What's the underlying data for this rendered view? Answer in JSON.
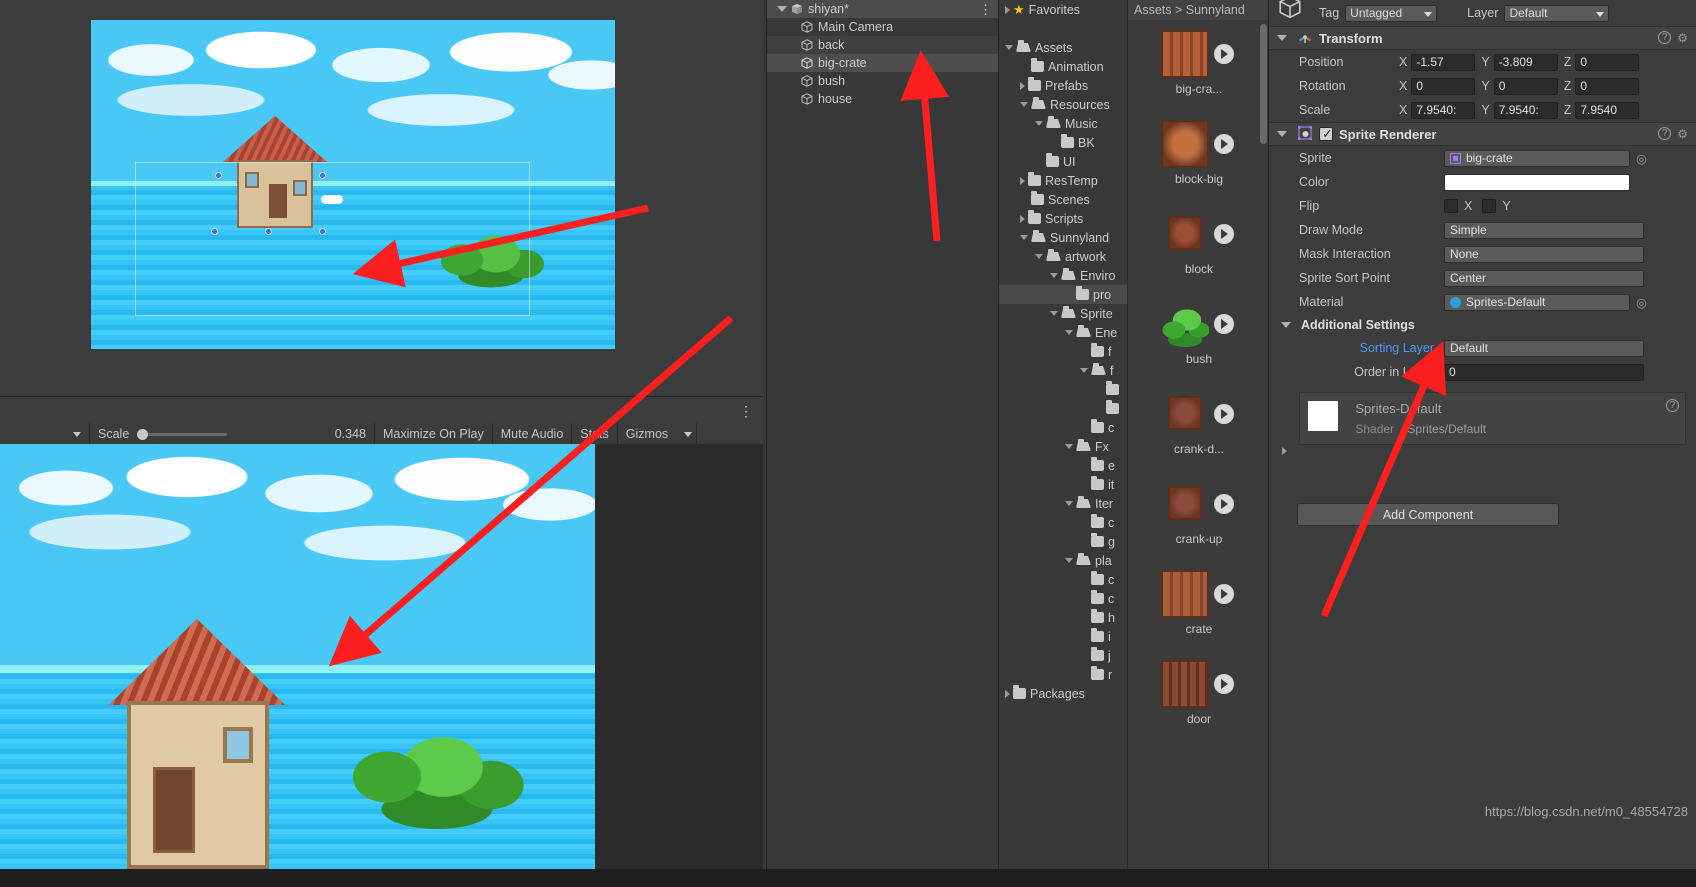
{
  "scene": {
    "frame_label": "scene-camera-frame"
  },
  "game_toolbar": {
    "scale_label": "Scale",
    "scale_value": "0.348",
    "maximize_label": "Maximize On Play",
    "mute_label": "Mute Audio",
    "stats_label": "Stats",
    "gizmos_label": "Gizmos"
  },
  "hierarchy": {
    "scene_name": "shiyan*",
    "items": [
      {
        "label": "Main Camera",
        "selected": false
      },
      {
        "label": "back",
        "selected": false
      },
      {
        "label": "big-crate",
        "selected": true
      },
      {
        "label": "bush",
        "selected": false
      },
      {
        "label": "house",
        "selected": false
      }
    ]
  },
  "project": {
    "favorites_label": "Favorites",
    "breadcrumb": "Assets  >  Sunnyland",
    "tree": [
      {
        "label": "Favorites",
        "depth": 0,
        "tri": "right",
        "icon": "star",
        "selected": false
      },
      {
        "label": "",
        "depth": 0,
        "tri": "blank",
        "icon": "none",
        "selected": false
      },
      {
        "label": "Assets",
        "depth": 0,
        "tri": "down",
        "icon": "folder-open",
        "selected": false
      },
      {
        "label": "Animation",
        "depth": 1,
        "tri": "blank",
        "icon": "folder",
        "selected": false
      },
      {
        "label": "Prefabs",
        "depth": 1,
        "tri": "right",
        "icon": "folder",
        "selected": false
      },
      {
        "label": "Resources",
        "depth": 1,
        "tri": "down",
        "icon": "folder-open",
        "selected": false
      },
      {
        "label": "Music",
        "depth": 2,
        "tri": "down",
        "icon": "folder-open",
        "selected": false
      },
      {
        "label": "BK",
        "depth": 3,
        "tri": "blank",
        "icon": "folder",
        "selected": false
      },
      {
        "label": "UI",
        "depth": 2,
        "tri": "blank",
        "icon": "folder",
        "selected": false
      },
      {
        "label": "ResTemp",
        "depth": 1,
        "tri": "right",
        "icon": "folder",
        "selected": false
      },
      {
        "label": "Scenes",
        "depth": 1,
        "tri": "blank",
        "icon": "folder",
        "selected": false
      },
      {
        "label": "Scripts",
        "depth": 1,
        "tri": "right",
        "icon": "folder",
        "selected": false
      },
      {
        "label": "Sunnyland",
        "depth": 1,
        "tri": "down",
        "icon": "folder-open",
        "selected": false
      },
      {
        "label": "artwork",
        "depth": 2,
        "tri": "down",
        "icon": "folder-open",
        "selected": false
      },
      {
        "label": "Enviro",
        "depth": 3,
        "tri": "down",
        "icon": "folder-open",
        "selected": false
      },
      {
        "label": "pro",
        "depth": 4,
        "tri": "blank",
        "icon": "folder",
        "selected": true
      },
      {
        "label": "Sprite",
        "depth": 3,
        "tri": "down",
        "icon": "folder-open",
        "selected": false
      },
      {
        "label": "Ene",
        "depth": 4,
        "tri": "down",
        "icon": "folder-open",
        "selected": false
      },
      {
        "label": "f",
        "depth": 5,
        "tri": "blank",
        "icon": "folder",
        "selected": false
      },
      {
        "label": "f",
        "depth": 5,
        "tri": "down",
        "icon": "folder-open",
        "selected": false
      },
      {
        "label": "",
        "depth": 6,
        "tri": "blank",
        "icon": "folder",
        "selected": false
      },
      {
        "label": "",
        "depth": 6,
        "tri": "blank",
        "icon": "folder",
        "selected": false
      },
      {
        "label": "c",
        "depth": 5,
        "tri": "blank",
        "icon": "folder",
        "selected": false
      },
      {
        "label": "Fx",
        "depth": 4,
        "tri": "down",
        "icon": "folder-open",
        "selected": false
      },
      {
        "label": "e",
        "depth": 5,
        "tri": "blank",
        "icon": "folder",
        "selected": false
      },
      {
        "label": "it",
        "depth": 5,
        "tri": "blank",
        "icon": "folder",
        "selected": false
      },
      {
        "label": "Iter",
        "depth": 4,
        "tri": "down",
        "icon": "folder-open",
        "selected": false
      },
      {
        "label": "c",
        "depth": 5,
        "tri": "blank",
        "icon": "folder",
        "selected": false
      },
      {
        "label": "g",
        "depth": 5,
        "tri": "blank",
        "icon": "folder",
        "selected": false
      },
      {
        "label": "pla",
        "depth": 4,
        "tri": "down",
        "icon": "folder-open",
        "selected": false
      },
      {
        "label": "c",
        "depth": 5,
        "tri": "blank",
        "icon": "folder",
        "selected": false
      },
      {
        "label": "c",
        "depth": 5,
        "tri": "blank",
        "icon": "folder",
        "selected": false
      },
      {
        "label": "h",
        "depth": 5,
        "tri": "blank",
        "icon": "folder",
        "selected": false
      },
      {
        "label": "i",
        "depth": 5,
        "tri": "blank",
        "icon": "folder",
        "selected": false
      },
      {
        "label": "j",
        "depth": 5,
        "tri": "blank",
        "icon": "folder",
        "selected": false
      },
      {
        "label": "r",
        "depth": 5,
        "tri": "blank",
        "icon": "folder",
        "selected": false
      },
      {
        "label": "Packages",
        "depth": 0,
        "tri": "right",
        "icon": "folder",
        "selected": false
      }
    ],
    "assets": [
      {
        "name": "big-cra...",
        "color": "#b5603a",
        "kind": "crate-tall"
      },
      {
        "name": "block-big",
        "color": "#c2703f",
        "kind": "block-big"
      },
      {
        "name": "block",
        "color": "#9c4f33",
        "kind": "block"
      },
      {
        "name": "bush",
        "color": "#4fba3c",
        "kind": "bush"
      },
      {
        "name": "crank-d...",
        "color": "#8d4a3a",
        "kind": "crank"
      },
      {
        "name": "crank-up",
        "color": "#8d4a3a",
        "kind": "crank"
      },
      {
        "name": "crate",
        "color": "#a8603c",
        "kind": "crate"
      },
      {
        "name": "door",
        "color": "#8a4a34",
        "kind": "door"
      }
    ]
  },
  "inspector": {
    "tag_label": "Tag",
    "tag_value": "Untagged",
    "layer_label": "Layer",
    "layer_value": "Default",
    "transform": {
      "title": "Transform",
      "rows": [
        {
          "name": "Position",
          "x": "-1.57",
          "y": "-3.809",
          "z": "0"
        },
        {
          "name": "Rotation",
          "x": "0",
          "y": "0",
          "z": "0"
        },
        {
          "name": "Scale",
          "x": "7.9540:",
          "y": "7.9540:",
          "z": "7.9540"
        }
      ],
      "axis_labels": [
        "X",
        "Y",
        "Z"
      ]
    },
    "sprite_renderer": {
      "title": "Sprite Renderer",
      "enabled": true,
      "sprite_label": "Sprite",
      "sprite_value": "big-crate",
      "color_label": "Color",
      "color_value": "#ffffff",
      "flip_label": "Flip",
      "flip_x_label": "X",
      "flip_y_label": "Y",
      "draw_mode_label": "Draw Mode",
      "draw_mode_value": "Simple",
      "mask_label": "Mask Interaction",
      "mask_value": "None",
      "sort_point_label": "Sprite Sort Point",
      "sort_point_value": "Center",
      "material_label": "Material",
      "material_value": "Sprites-Default",
      "additional_title": "Additional Settings",
      "sorting_layer_label": "Sorting Layer",
      "sorting_layer_value": "Default",
      "order_label": "Order in Layer",
      "order_value": "0"
    },
    "material_box": {
      "title": "Sprites-Default",
      "shader_label": "Shader",
      "shader_value": "Sprites/Default"
    },
    "add_component_label": "Add Component"
  },
  "watermark": "https://blog.csdn.net/m0_48554728",
  "colors": {
    "accent_blue": "#4f9bf7",
    "arrow_red": "#fb1f1f",
    "panel_bg": "#383838"
  }
}
